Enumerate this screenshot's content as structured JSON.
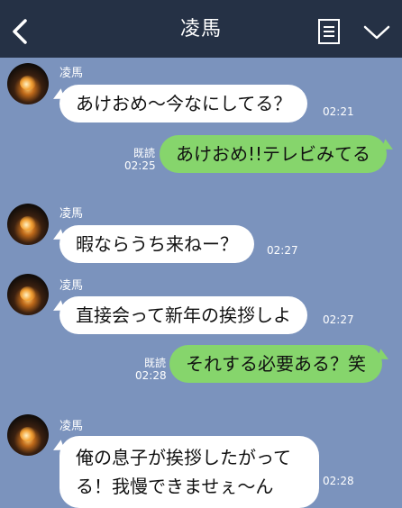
{
  "header": {
    "title": "凌馬",
    "icons": [
      "back-icon",
      "notes-icon",
      "chevron-down-icon"
    ]
  },
  "colors": {
    "header_bg": "#253145",
    "chat_bg": "#7b93bd",
    "incoming_bubble": "#ffffff",
    "outgoing_bubble": "#86d56c"
  },
  "messages": [
    {
      "side": "left",
      "sender": "凌馬",
      "text": "あけおめ〜今なにしてる？",
      "time": "02:21"
    },
    {
      "side": "right",
      "read_label": "既読",
      "text": "あけおめ!!テレビみてる",
      "time": "02:25"
    },
    {
      "side": "left",
      "sender": "凌馬",
      "text": "暇ならうち来ねー？",
      "time": "02:27"
    },
    {
      "side": "left",
      "sender": "凌馬",
      "text": "直接会って新年の挨拶しよ",
      "time": "02:27"
    },
    {
      "side": "right",
      "read_label": "既読",
      "text": "それする必要ある？笑",
      "time": "02:28"
    },
    {
      "side": "left",
      "sender": "凌馬",
      "lines": [
        "俺の息子が挨拶したがって",
        "る！我慢できませぇ〜ん"
      ],
      "time": "02:28"
    }
  ]
}
